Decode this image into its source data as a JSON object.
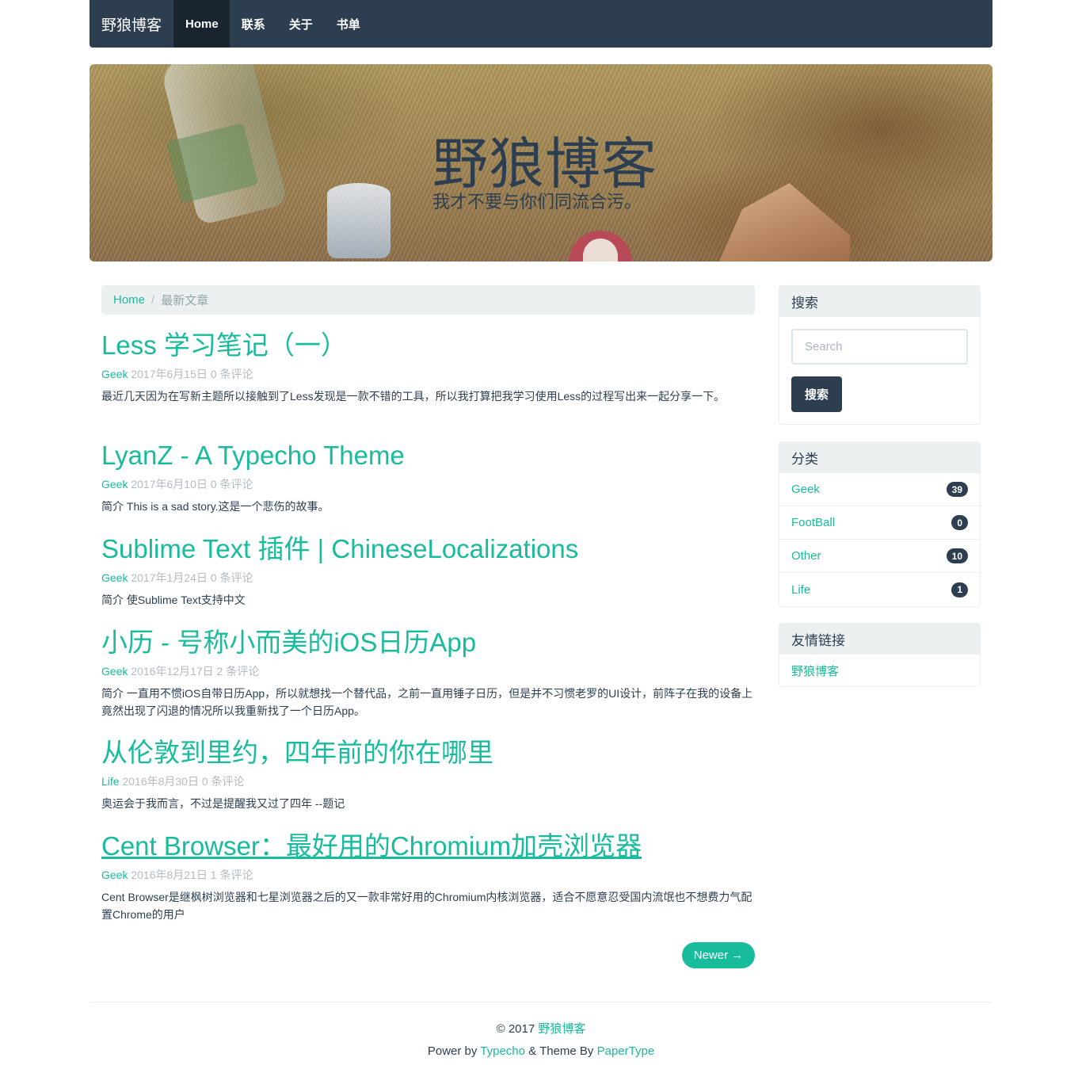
{
  "nav": {
    "brand": "野狼博客",
    "items": [
      {
        "label": "Home"
      },
      {
        "label": "联系"
      },
      {
        "label": "关于"
      },
      {
        "label": "书单"
      }
    ]
  },
  "hero": {
    "title": "野狼博客",
    "subtitle": "我才不要与你们同流合污。"
  },
  "breadcrumb": {
    "home": "Home",
    "separator": "/",
    "current": "最新文章"
  },
  "posts": [
    {
      "title": "Less 学习笔记（一）",
      "category": "Geek",
      "date": "2017年6月15日",
      "comments": "0 条评论",
      "excerpt": "最近几天因为在写新主题所以接触到了Less发现是一款不错的工具，所以我打算把我学习使用Less的过程写出来一起分享一下。"
    },
    {
      "title": "LyanZ - A Typecho Theme",
      "category": "Geek",
      "date": "2017年6月10日",
      "comments": "0 条评论",
      "excerpt": "简介 This is a sad story.这是一个悲伤的故事。"
    },
    {
      "title": "Sublime Text 插件 | ChineseLocalizations",
      "category": "Geek",
      "date": "2017年1月24日",
      "comments": "0 条评论",
      "excerpt": "简介 使Sublime Text支持中文"
    },
    {
      "title": "小历 - 号称小而美的iOS日历App",
      "category": "Geek",
      "date": "2016年12月17日",
      "comments": "2 条评论",
      "excerpt": "简介 一直用不惯iOS自带日历App，所以就想找一个替代品，之前一直用锤子日历，但是并不习惯老罗的UI设计，前阵子在我的设备上竟然出现了闪退的情况所以我重新找了一个日历App。"
    },
    {
      "title": "从伦敦到里约，四年前的你在哪里",
      "category": "Life",
      "date": "2016年8月30日",
      "comments": "0 条评论",
      "excerpt": "奥运会于我而言，不过是提醒我又过了四年 --题记"
    },
    {
      "title": "Cent Browser：最好用的Chromium加壳浏览器",
      "category": "Geek",
      "date": "2016年8月21日",
      "comments": "1 条评论",
      "excerpt": "Cent Browser是继枫树浏览器和七星浏览器之后的又一款非常好用的Chromium内核浏览器，适合不愿意忍受国内流氓也不想费力气配置Chrome的用户"
    }
  ],
  "pager": {
    "newer": "Newer →"
  },
  "sidebar": {
    "search": {
      "heading": "搜索",
      "placeholder": "Search",
      "button": "搜索"
    },
    "categories": {
      "heading": "分类",
      "items": [
        {
          "name": "Geek",
          "count": "39"
        },
        {
          "name": "FootBall",
          "count": "0"
        },
        {
          "name": "Other",
          "count": "10"
        },
        {
          "name": "Life",
          "count": "1"
        }
      ]
    },
    "links": {
      "heading": "友情链接",
      "items": [
        {
          "name": "野狼博客"
        }
      ]
    }
  },
  "footer": {
    "copyright": "© 2017",
    "site": "野狼博客",
    "power_by": "Power by",
    "typecho": "Typecho",
    "theme_by": "& Theme By",
    "papertype": "PaperType"
  },
  "colors": {
    "primary": "#2c3e50",
    "accent": "#18bc9c",
    "muted": "#b4bcc2",
    "panel_bg": "#ecf0f1"
  }
}
